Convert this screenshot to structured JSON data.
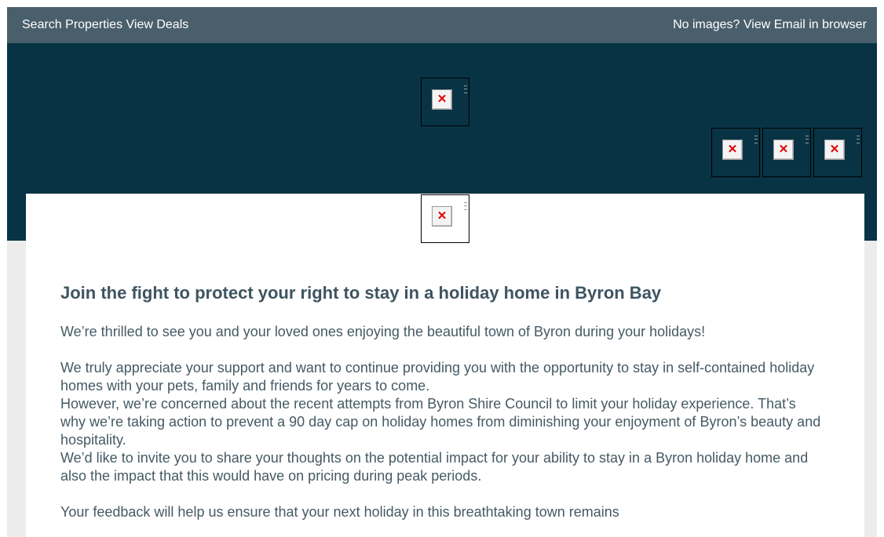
{
  "topbar": {
    "search_link": "Search Properties",
    "deals_link": "View Deals",
    "browser_link": "No images? View Email in browser"
  },
  "images": {
    "logo": "broken-image-icon",
    "social": [
      "broken-image-icon",
      "broken-image-icon",
      "broken-image-icon"
    ],
    "banner": "broken-image-icon"
  },
  "content": {
    "headline": "Join the fight to protect your right to stay in a holiday home in Byron Bay",
    "paragraphs": [
      "We’re thrilled to see you and your loved ones enjoying the beautiful town of Byron during your holidays!",
      "We truly appreciate your support and want to continue providing you with the opportunity to stay in self-contained holiday homes with your pets, family and friends for years to come.",
      "However, we’re concerned about the recent attempts from Byron Shire Council to limit your holiday experience. That’s why we’re taking action to prevent a 90 day cap on holiday homes from diminishing your enjoyment of Byron’s beauty and hospitality.",
      "We’d like to invite you to share your thoughts on the potential impact for your ability to stay in a Byron holiday home and also the impact that this would have on pricing during peak periods.",
      "Your feedback will help us ensure that your next holiday in this breathtaking town remains"
    ]
  },
  "colors": {
    "topbar": "#4a5f6c",
    "hero": "#083344",
    "headline": "#3e5461",
    "body_text": "#455a64",
    "background": "#ececec"
  }
}
